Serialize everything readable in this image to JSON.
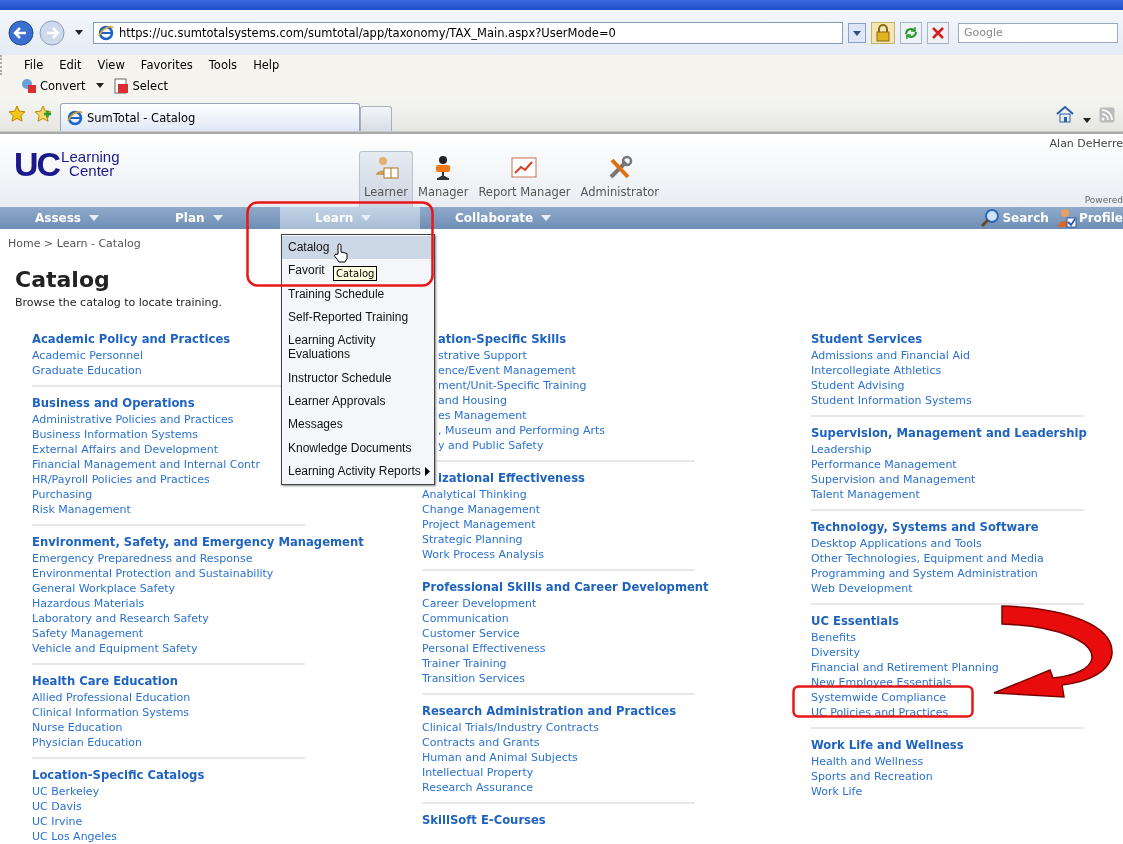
{
  "browser": {
    "address": {
      "url": "https://uc.sumtotalsystems.com/sumtotal/app/taxonomy/TAX_Main.aspx?UserMode=0"
    },
    "search": {
      "placeholder": "Google"
    },
    "menu_bar": [
      "File",
      "Edit",
      "View",
      "Favorites",
      "Tools",
      "Help"
    ],
    "toolbar": [
      {
        "label": "Convert",
        "kind": "convert"
      },
      {
        "label": "Select",
        "kind": "select"
      }
    ],
    "tabs": [
      {
        "label": "SumTotal - Catalog",
        "selected": true
      }
    ]
  },
  "app": {
    "logo": {
      "mark": "UC",
      "line_1": "Learning",
      "line_2": "Center"
    },
    "user": "Alan DeHerre",
    "powered": "Powered",
    "roles": [
      {
        "label": "Learner",
        "kind": "learner",
        "selected": true
      },
      {
        "label": "Manager",
        "kind": "manager",
        "selected": false
      },
      {
        "label": "Report Manager",
        "kind": "report",
        "selected": false
      },
      {
        "label": "Administrator",
        "kind": "admin",
        "selected": false
      }
    ],
    "nav": [
      {
        "label": "Assess",
        "selected": false
      },
      {
        "label": "Plan",
        "selected": false
      },
      {
        "label": "Learn",
        "selected": true
      },
      {
        "label": "Collaborate",
        "selected": false
      }
    ],
    "nav_right": [
      {
        "label": "Search",
        "kind": "search"
      },
      {
        "label": "Profile",
        "kind": "profile"
      }
    ]
  },
  "breadcrumb": "Home > Learn - Catalog",
  "title": "Catalog",
  "subtitle": "Browse the catalog to locate training.",
  "columns": [
    [
      {
        "heading": "Academic Policy and Practices",
        "items": [
          "Academic Personnel",
          "Graduate Education"
        ]
      },
      {
        "heading": "Business and Operations",
        "items": [
          "Administrative Policies and Practices",
          "Business Information Systems",
          "External Affairs and Development",
          "Financial Management and Internal Contr",
          "HR/Payroll Policies and Practices",
          "Purchasing",
          "Risk Management"
        ]
      },
      {
        "heading": "Environment, Safety, and Emergency Management",
        "items": [
          "Emergency Preparedness and Response",
          "Environmental Protection and Sustainability",
          "General Workplace Safety",
          "Hazardous Materials",
          "Laboratory and Research Safety",
          "Safety Management",
          "Vehicle and Equipment Safety"
        ]
      },
      {
        "heading": "Health Care Education",
        "items": [
          "Allied Professional Education",
          "Clinical Information Systems",
          "Nurse Education",
          "Physician Education"
        ]
      },
      {
        "heading": "Location-Specific Catalogs",
        "items": [
          "UC Berkeley",
          "UC Davis",
          "UC Irvine",
          "UC Los Angeles"
        ]
      }
    ],
    [
      {
        "heading": "ation-Specific Skills",
        "heading_covered": true,
        "items_covered": true,
        "items": [
          "strative Support",
          "ence/Event Management",
          "ment/Unit-Specific Training",
          "and Housing",
          "es Management",
          ", Museum and Performing Arts",
          "y and Public Safety"
        ]
      },
      {
        "heading": "izational Effectiveness",
        "heading_covered": true,
        "items": [
          "Analytical Thinking",
          "Change Management",
          "Project Management",
          "Strategic Planning",
          "Work Process Analysis"
        ]
      },
      {
        "heading": "Professional Skills and Career Development",
        "items": [
          "Career Development",
          "Communication",
          "Customer Service",
          "Personal Effectiveness",
          "Trainer Training",
          "Transition Services"
        ]
      },
      {
        "heading": "Research Administration and Practices",
        "items": [
          "Clinical Trials/Industry Contracts",
          "Contracts and Grants",
          "Human and Animal Subjects",
          "Intellectual Property",
          "Research Assurance"
        ]
      },
      {
        "heading": "SkillSoft E-Courses"
      }
    ],
    [
      {
        "heading": "Student Services",
        "items": [
          "Admissions and Financial Aid",
          "Intercollegiate Athletics",
          "Student Advising",
          "Student Information Systems"
        ]
      },
      {
        "heading": "Supervision, Management and Leadership",
        "items": [
          "Leadership",
          "Performance Management",
          "Supervision and Management",
          "Talent Management"
        ]
      },
      {
        "heading": "Technology, Systems and Software",
        "items": [
          "Desktop Applications and Tools",
          "Other Technologies, Equipment and Media",
          "Programming and System Administration",
          "Web Development"
        ]
      },
      {
        "heading": "UC Essentials",
        "items": [
          "Benefits",
          "Diversity",
          "Financial and Retirement Planning",
          "New Employee Essentials",
          "Systemwide Compliance",
          "UC Policies and Practices"
        ]
      },
      {
        "heading": "Work Life and Wellness",
        "items": [
          "Health and Wellness",
          "Sports and Recreation",
          "Work Life"
        ]
      }
    ]
  ],
  "menu": {
    "items": [
      {
        "label": "Catalog",
        "selected": true
      },
      {
        "label": "Favorit",
        "selected": false
      },
      {
        "label": "Training Schedule",
        "selected": false
      },
      {
        "label": "Self-Reported Training",
        "selected": false
      },
      {
        "label": "Learning Activity Evaluations",
        "selected": false
      },
      {
        "label": "Instructor Schedule",
        "selected": false
      },
      {
        "label": "Learner Approvals",
        "selected": false
      },
      {
        "label": "Messages",
        "selected": false
      },
      {
        "label": "Knowledge Documents",
        "selected": false
      },
      {
        "label": "Learning Activity Reports",
        "selected": false,
        "submenu": true
      }
    ]
  },
  "tooltip": "Catalog"
}
